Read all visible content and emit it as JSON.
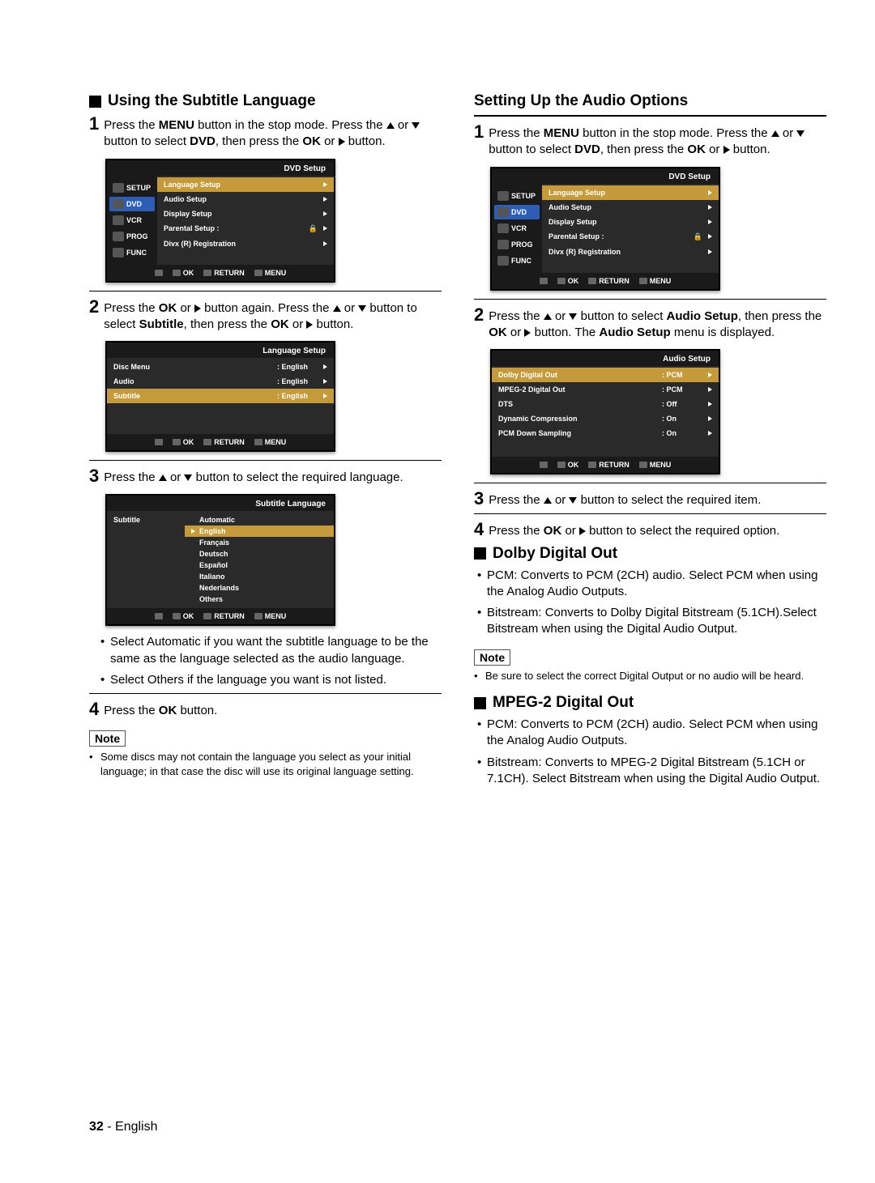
{
  "page": {
    "number": "32",
    "sep": " - ",
    "lang": "English"
  },
  "left": {
    "h1": "Using the Subtitle Language",
    "step1": {
      "a": "Press the ",
      "menu": "MENU",
      "b": " button in the stop mode. Press the ",
      "c": " or ",
      "d": " button to select ",
      "dvd": "DVD",
      "e": ", then press the ",
      "ok": "OK",
      "f": " or ",
      "g": " button."
    },
    "osd1": {
      "title": "DVD  Setup",
      "side": [
        "SETUP",
        "DVD",
        "VCR",
        "PROG",
        "FUNC"
      ],
      "rows": [
        "Language Setup",
        "Audio Setup",
        "Display Setup",
        "Parental Setup :",
        "Divx (R) Registration"
      ],
      "footer": {
        "ok": "OK",
        "return": "RETURN",
        "menu": "MENU"
      }
    },
    "step2": {
      "a": "Press the ",
      "ok": "OK",
      "b": " or ",
      "c": " button again. Press the ",
      "d": " or ",
      "e": " button to select ",
      "sub": "Subtitle",
      "f": ", then press the ",
      "ok2": "OK",
      "g": " or ",
      "h": " button."
    },
    "osd2": {
      "title": "Language Setup",
      "rows": [
        {
          "l": "Disc Menu",
          "v": ": English"
        },
        {
          "l": "Audio",
          "v": ": English"
        },
        {
          "l": "Subtitle",
          "v": ": English"
        }
      ],
      "footer": {
        "ok": "OK",
        "return": "RETURN",
        "menu": "MENU"
      }
    },
    "step3": {
      "a": " Press the ",
      "b": " or ",
      "c": " button to select the required language."
    },
    "osd3": {
      "title": "Subtitle Language",
      "left": "Subtitle",
      "items": [
        "Automatic",
        "English",
        "Français",
        "Deutsch",
        "Español",
        "Italiano",
        "Nederlands",
        "Others"
      ],
      "footer": {
        "ok": "OK",
        "return": "RETURN",
        "menu": "MENU"
      }
    },
    "bul1": {
      "a": "Select ",
      "auto": "Automatic",
      "b": " if you want the subtitle language to be the same as the language selected as the audio language."
    },
    "bul2": {
      "a": "Select ",
      "oth": "Others",
      "b": " if the language you want is not listed."
    },
    "step4": {
      "a": "Press the ",
      "ok": "OK",
      "b": " button."
    },
    "noteLabel": "Note",
    "note": "Some discs may not contain the language you select as your initial language; in that case the disc will use its original language setting."
  },
  "right": {
    "h1": "Setting Up the Audio Options",
    "step1": {
      "a": "Press the ",
      "menu": "MENU",
      "b": " button in the stop mode. Press the ",
      "c": " or ",
      "d": " button to select ",
      "dvd": "DVD",
      "e": ", then press the ",
      "ok": "OK",
      "f": " or ",
      "g": " button."
    },
    "osd1": {
      "title": "DVD  Setup",
      "side": [
        "SETUP",
        "DVD",
        "VCR",
        "PROG",
        "FUNC"
      ],
      "rows": [
        "Language Setup",
        "Audio Setup",
        "Display Setup",
        "Parental Setup :",
        "Divx (R) Registration"
      ],
      "footer": {
        "ok": "OK",
        "return": "RETURN",
        "menu": "MENU"
      }
    },
    "step2": {
      "a": "Press the ",
      "b": " or ",
      "c": " button to select ",
      "as": "Audio Setup",
      "d": ", then press the ",
      "ok": "OK",
      "e": " or ",
      "f": " button. The ",
      "as2": "Audio Setup",
      "g": " menu is displayed."
    },
    "osd2": {
      "title": "Audio Setup",
      "rows": [
        {
          "l": "Dolby Digital Out",
          "v": ": PCM"
        },
        {
          "l": "MPEG-2 Digital Out",
          "v": ": PCM"
        },
        {
          "l": "DTS",
          "v": ": Off"
        },
        {
          "l": "Dynamic Compression",
          "v": ": On"
        },
        {
          "l": "PCM Down Sampling",
          "v": ": On"
        }
      ],
      "footer": {
        "ok": "OK",
        "return": "RETURN",
        "menu": "MENU"
      }
    },
    "step3": {
      "a": "Press the ",
      "b": " or ",
      "c": " button to select the required item."
    },
    "step4": {
      "a": "Press the ",
      "ok": "OK",
      "b": " or ",
      "c": " button to select the required option."
    },
    "dolby": {
      "h": "Dolby Digital Out",
      "pcm": {
        "lbl": "PCM",
        "t": ": Converts to PCM (2CH) audio. Select PCM when using the Analog Audio Outputs."
      },
      "bit": {
        "lbl": "Bitstream",
        "t": ": Converts to Dolby Digital Bitstream (5.1CH).Select Bitstream when using the Digital Audio Output."
      }
    },
    "noteLabel": "Note",
    "note": "Be sure to select the correct Digital Output or no audio will be heard.",
    "mpeg": {
      "h": "MPEG-2 Digital Out",
      "pcm": {
        "lbl": "PCM",
        "t": ": Converts to PCM (2CH) audio. Select PCM when using the Analog Audio Outputs."
      },
      "bit": {
        "lbl": "Bitstream",
        "t": ": Converts to MPEG-2 Digital Bitstream (5.1CH or 7.1CH). Select Bitstream when using the Digital Audio Output."
      }
    }
  }
}
